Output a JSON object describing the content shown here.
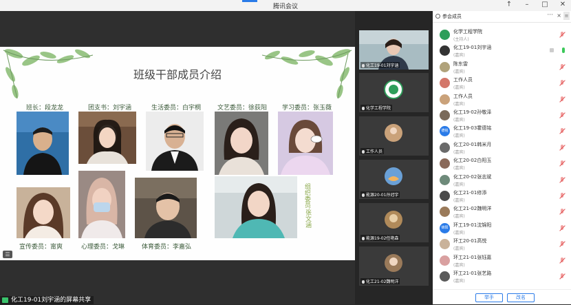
{
  "window": {
    "title": "腾讯会议"
  },
  "stage": {
    "slide_title": "班级干部成员介绍",
    "captions": {
      "monitor": "班长：段龙龙",
      "league": "团支书：刘宇涵",
      "life": "生活委员：白宇桐",
      "arts": "文艺委员：徐荻阳",
      "study": "学习委员：张玉薇",
      "publicity": "宣传委员：甯爽",
      "psych": "心理委员：戈琳",
      "sports": "体育委员：李嘉弘",
      "organize_a": "组织委员：",
      "organize_b": "张文涵"
    },
    "share_label": "化工19-01刘宇涵的屏幕共享"
  },
  "video_strip": [
    {
      "name": "化工19-01刘宇涵"
    },
    {
      "name": "化学工程学院"
    },
    {
      "name": "工作人员"
    },
    {
      "name": "能源20-01孙冠宇"
    },
    {
      "name": "能源19-02任艳森"
    },
    {
      "name": "化工21-02魏明洋"
    }
  ],
  "participants_panel": {
    "title": "参会成员",
    "more": "···",
    "close": "×",
    "members": [
      {
        "name": "化学工程学院",
        "role": "(主持人)",
        "avatar_color": "#2e9e5a"
      },
      {
        "name": "化工19-01刘宇涵",
        "role": "(嘉宾)",
        "avatar_color": "#333333"
      },
      {
        "name": "陈东雷",
        "role": "(嘉宾)",
        "avatar_color": "#b0a27a"
      },
      {
        "name": "工作人员",
        "role": "(嘉宾)",
        "avatar_color": "#d3776a"
      },
      {
        "name": "工作人员",
        "role": "(嘉宾)",
        "avatar_color": "#caa27a"
      },
      {
        "name": "化工19-02孙敬泽",
        "role": "(嘉宾)",
        "avatar_color": "#7a6a5a"
      },
      {
        "name": "化工19-03霍德铭",
        "role": "(嘉宾)",
        "avatar_color": "#2a7be8",
        "avatar_text": "德铭"
      },
      {
        "name": "化工20-01韩米月",
        "role": "(嘉宾)",
        "avatar_color": "#6a6a6a"
      },
      {
        "name": "化工20-02白阳玉",
        "role": "(嘉宾)",
        "avatar_color": "#8a6a5a"
      },
      {
        "name": "化工20-02张志斌",
        "role": "(嘉宾)",
        "avatar_color": "#6e8a7a"
      },
      {
        "name": "化工21-01修添",
        "role": "(嘉宾)",
        "avatar_color": "#4a4a4a"
      },
      {
        "name": "化工21-02魏明洋",
        "role": "(嘉宾)",
        "avatar_color": "#9a7a5a"
      },
      {
        "name": "环工19-01沈锦阳",
        "role": "(嘉宾)",
        "avatar_color": "#2a7be8",
        "avatar_text": "锦阳"
      },
      {
        "name": "环工20-01高悦",
        "role": "(嘉宾)",
        "avatar_color": "#c9b29a"
      },
      {
        "name": "环工21-01张钰嘉",
        "role": "(嘉宾)",
        "avatar_color": "#d9a0a0"
      },
      {
        "name": "环工21-01张艺路",
        "role": "(嘉宾)",
        "avatar_color": "#5a5a5a"
      }
    ],
    "raise_hand_label": "举手",
    "rename_label": "改名",
    "colors": {
      "accent": "#2a7be8",
      "muted_red": "#e05555",
      "mic_green": "#3cc85a"
    }
  }
}
